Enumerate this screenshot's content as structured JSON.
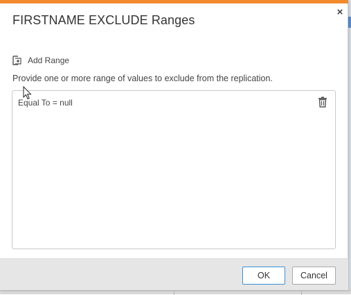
{
  "dialog": {
    "title": "FIRSTNAME EXCLUDE Ranges",
    "close_label": "×",
    "add_range_label": "Add Range",
    "description": "Provide one or more range of values to exclude from the replication.",
    "ranges": [
      {
        "text": "Equal To = null"
      }
    ],
    "ok_label": "OK",
    "cancel_label": "Cancel"
  },
  "colors": {
    "accent": "#f28a2e",
    "ok_border": "#3b8fd4",
    "footer_bg": "#e6e6e6"
  },
  "icons": [
    "close-icon",
    "add-range-icon",
    "trash-icon",
    "mouse-cursor-icon"
  ]
}
